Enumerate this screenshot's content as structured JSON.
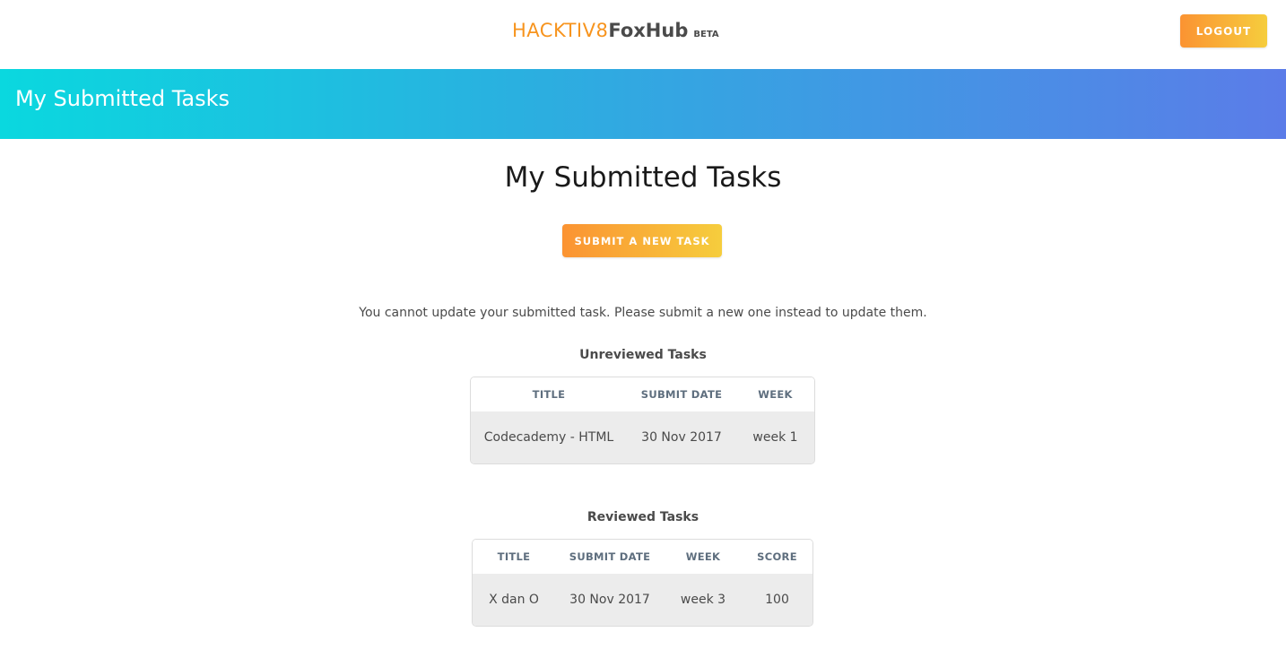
{
  "header": {
    "logo": {
      "part1": "HACKTIV8",
      "part2": "FoxHub",
      "badge": "BETA"
    },
    "logout_label": "LOGOUT",
    "accent_color": "#f7941e"
  },
  "banner": {
    "title": "My Submitted Tasks"
  },
  "main": {
    "title": "My Submitted Tasks",
    "submit_label": "SUBMIT A NEW TASK",
    "notice": "You cannot update your submitted task. Please submit a new one instead to update them."
  },
  "unreviewed": {
    "title": "Unreviewed Tasks",
    "columns": [
      "TITLE",
      "SUBMIT DATE",
      "WEEK"
    ],
    "rows": [
      {
        "title": "Codecademy - HTML",
        "submit_date": "30 Nov 2017",
        "week": "week 1"
      }
    ]
  },
  "reviewed": {
    "title": "Reviewed Tasks",
    "columns": [
      "TITLE",
      "SUBMIT DATE",
      "WEEK",
      "SCORE"
    ],
    "rows": [
      {
        "title": "X dan O",
        "submit_date": "30 Nov 2017",
        "week": "week 3",
        "score": "100"
      }
    ]
  }
}
